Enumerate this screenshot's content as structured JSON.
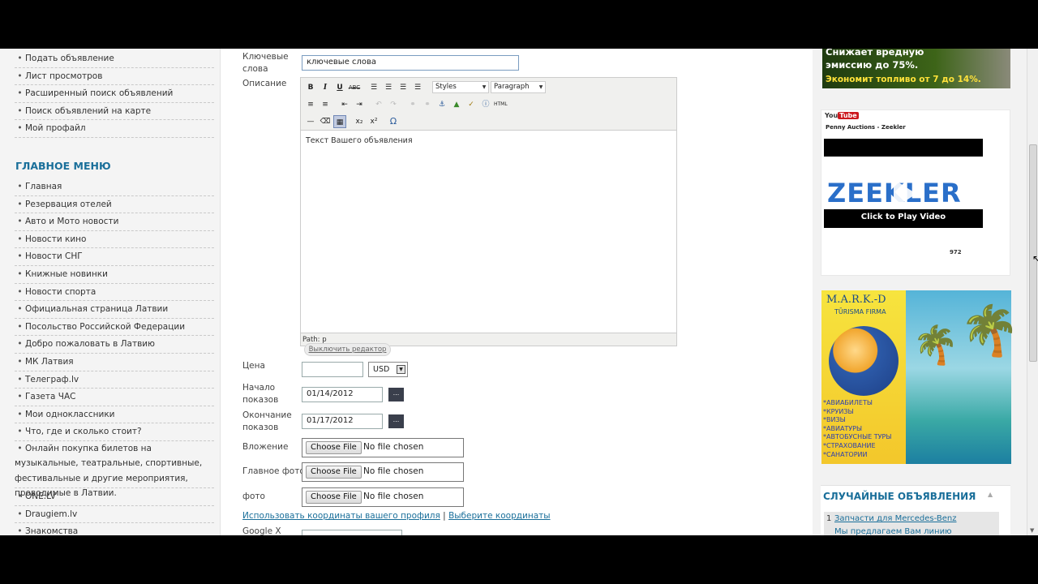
{
  "sidebar": {
    "top_items": [
      "Подать объявление",
      "Лист просмотров",
      "Расширенный поиск объявлений",
      "Поиск объявлений на карте",
      "Мой профайл"
    ],
    "menu_title": "ГЛАВНОЕ МЕНЮ",
    "menu_items": [
      "Главная",
      "Резервация отелей",
      "Авто и Мото новости",
      "Новости кино",
      "Новости СНГ",
      "Книжные новинки",
      "Новости спорта",
      "Официальная страница Латвии",
      "Посольство Российской Федерации",
      "Добро пожаловать в Латвию",
      "МК Латвия",
      "Телеграф.lv",
      "Газета ЧАС",
      "Мои одноклассники",
      "Что, где и сколько стоит?"
    ],
    "multi_item": "Онлайн покупка билетов на музыкальные, театральные, спортивные, фестивальные и другие мероприятия, проводимые в Латвии.",
    "bottom_items": [
      "ONE.LV",
      "Draugiem.lv",
      "Знакомства"
    ],
    "bullet": "•"
  },
  "form": {
    "keywords_label_1": "Ключевые",
    "keywords_label_2": "слова",
    "keywords_value": "ключевые слова",
    "description_label": "Описание",
    "toolbar": {
      "bold": "B",
      "italic": "I",
      "underline": "U",
      "strike": "ABC",
      "styles": "Styles",
      "paragraph": "Paragraph",
      "html": "HTML",
      "sub": "x₂",
      "sup": "x²",
      "omega": "Ω"
    },
    "editor_text": "Текст Вашего объявления",
    "path": "Path: p",
    "toggle_editor": "Выключить редактор",
    "price_label": "Цена",
    "currency": "USD",
    "start_label_1": "Начало",
    "start_label_2": "показов",
    "start_date": "01/14/2012",
    "end_label_1": "Окончание",
    "end_label_2": "показов",
    "end_date": "01/17/2012",
    "dots": "...",
    "attachment_label": "Вложение",
    "main_photo_label": "Главное фото",
    "photo_label": "фото",
    "choose_file": "Choose File",
    "no_file": "No file chosen",
    "use_coords_link": "Использовать координаты вашего профиля",
    "separator": "|",
    "select_coords_link": "Выберите координаты",
    "google_x_label": "Google X"
  },
  "right": {
    "ad_eco_1": "Снижает вредную",
    "ad_eco_2": "эмиссию до 75%.",
    "ad_eco_3": "Экономит топливо от 7 до 14%.",
    "yt_logo_you": "You",
    "yt_logo_tube": "Tube",
    "yt_title": "Penny Auctions - Zeekler",
    "zeekler": "ZEEKLER",
    "click_to_play": "Click to Play Video",
    "yt_views": "972",
    "mark_title": "M.A.R.K.-D",
    "mark_subtitle": "TŪRISMA FIRMA",
    "mark_items": [
      "*АВИАБИЛЕТЫ",
      "*КРУИЗЫ",
      "*ВИЗЫ",
      "*АВИАТУРЫ",
      "*АВТОБУСНЫЕ ТУРЫ",
      "*СТРАХОВАНИЕ",
      "*САНАТОРИИ"
    ],
    "random_title": "СЛУЧАЙНЫЕ ОБЪЯВЛЕНИЯ",
    "random_num": "1",
    "random_link": "Запчасти для Mercedes-Benz",
    "random_desc": "Мы предлагаем Вам линию"
  },
  "colors": {
    "accent": "#1a6f9a",
    "page_bg": "#f2f2f2"
  }
}
